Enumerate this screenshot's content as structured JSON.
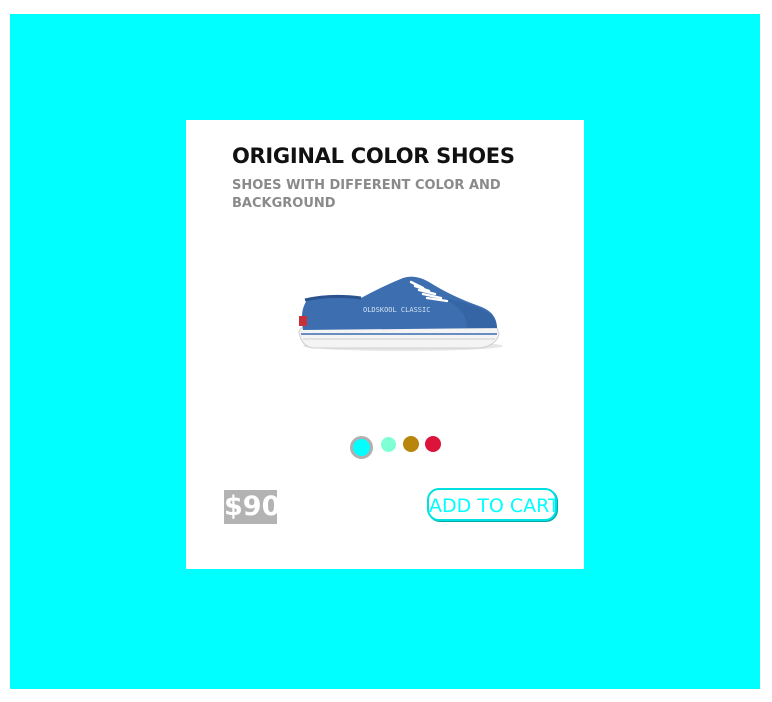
{
  "colors": {
    "page_background": "#00ffff",
    "card_background": "#ffffff",
    "accent": "#00ffff",
    "price_background": "#b3b3b3"
  },
  "product": {
    "title": "ORIGINAL COLOR SHOES",
    "subtitle": "SHOES WITH DIFFERENT COLOR AND BACKGROUND",
    "image_icon": "blue-canvas-sneaker-image",
    "shoe_print": "OLDSKOOL CLASSIC",
    "price": "$90",
    "add_to_cart_label": "ADD TO CART"
  },
  "swatches": [
    {
      "color": "#00ffff",
      "selected": true
    },
    {
      "color": "#7fffd4",
      "selected": false
    },
    {
      "color": "#b8860b",
      "selected": false
    },
    {
      "color": "#dc143c",
      "selected": false
    }
  ]
}
